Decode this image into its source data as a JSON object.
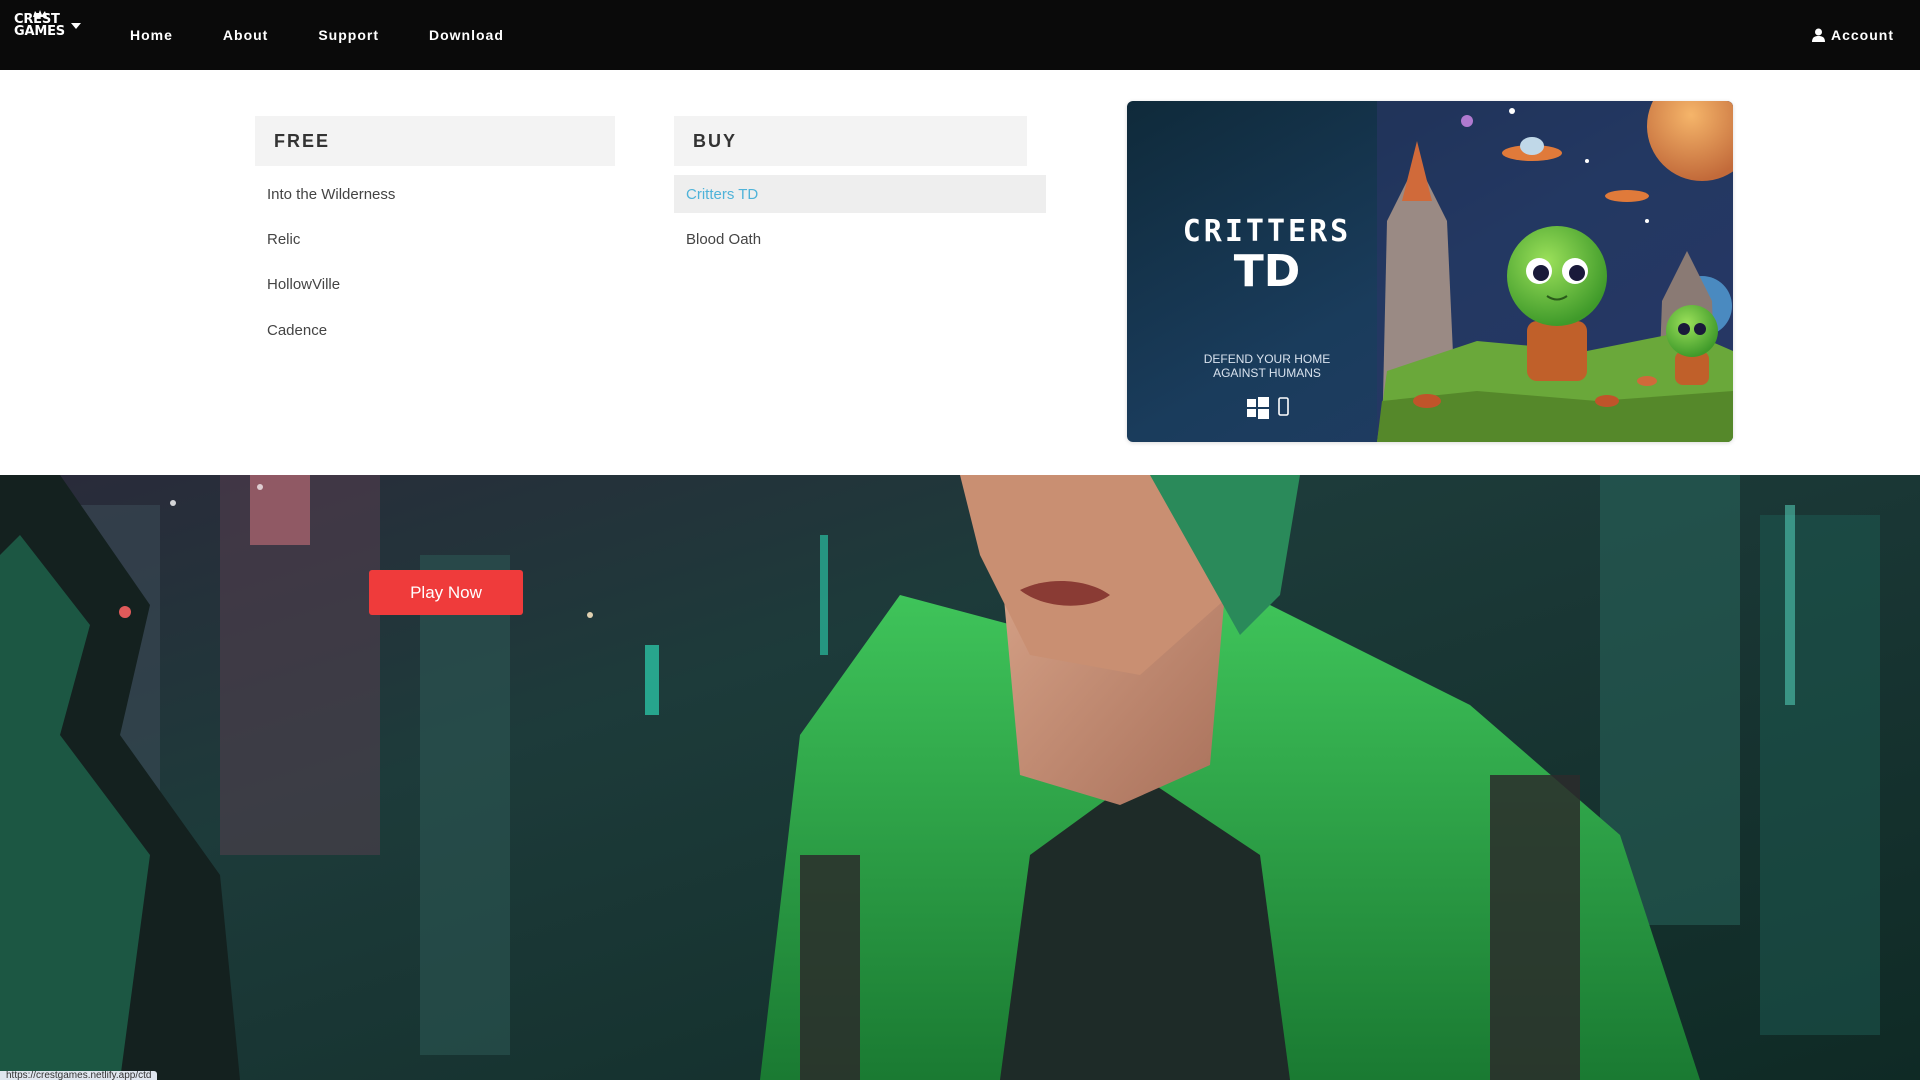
{
  "nav": {
    "brand_line1": "CREST",
    "brand_line2": "GAMES",
    "links": [
      "Home",
      "About",
      "Support",
      "Download"
    ],
    "account_label": "Account"
  },
  "menu": {
    "free_heading": "FREE",
    "free_items": [
      "Into the Wilderness",
      "Relic",
      "HollowVille",
      "Cadence"
    ],
    "buy_heading": "BUY",
    "buy_items": [
      "Critters TD",
      "Blood Oath"
    ],
    "active_item": "Critters TD",
    "active_color": "#4fb3d9"
  },
  "promo": {
    "title_line1": "CRITTERS",
    "title_line2": "TD",
    "tagline_line1": "DEFEND YOUR HOME",
    "tagline_line2": "AGAINST HUMANS",
    "platform_icons": [
      "windows-icon",
      "mobile-icon"
    ]
  },
  "hero": {
    "cta_label": "Play Now",
    "cta_color": "#ef3b3b"
  },
  "status_bar": {
    "url": "https://crestgames.netlify.app/ctd"
  }
}
